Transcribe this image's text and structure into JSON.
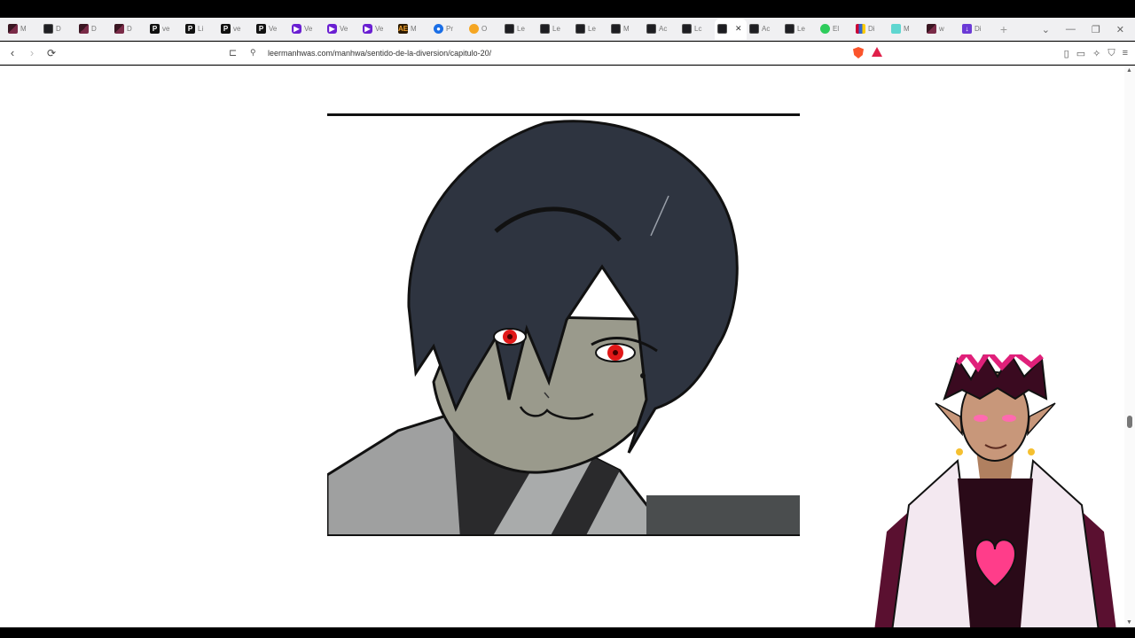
{
  "browser": {
    "tabs": [
      {
        "favicon": "manga-dark-favicon",
        "label": "M"
      },
      {
        "favicon": "manga-favicon",
        "label": "D"
      },
      {
        "favicon": "manga-dark-favicon",
        "label": "D"
      },
      {
        "favicon": "manga-dark-favicon",
        "label": "D"
      },
      {
        "favicon": "p-favicon",
        "label": "ve"
      },
      {
        "favicon": "p-favicon",
        "label": "Li"
      },
      {
        "favicon": "p-favicon",
        "label": "ve"
      },
      {
        "favicon": "p-favicon",
        "label": "Ve"
      },
      {
        "favicon": "purple-play-favicon",
        "label": "Ve"
      },
      {
        "favicon": "purple-play-favicon",
        "label": "Ve"
      },
      {
        "favicon": "purple-play-favicon",
        "label": "Ve"
      },
      {
        "favicon": "ae-favicon",
        "label": "M"
      },
      {
        "favicon": "blue-circle-favicon",
        "label": "Pr"
      },
      {
        "favicon": "orange-favicon",
        "label": "O"
      },
      {
        "favicon": "manga-favicon",
        "label": "Le"
      },
      {
        "favicon": "manga-favicon",
        "label": "Le"
      },
      {
        "favicon": "manga-favicon",
        "label": "Le"
      },
      {
        "favicon": "manga-favicon",
        "label": "M"
      },
      {
        "favicon": "manga-favicon",
        "label": "Ac"
      },
      {
        "favicon": "manga-favicon",
        "label": "Lc"
      }
    ],
    "active_tab": {
      "favicon": "manga-favicon",
      "label": "",
      "close": "✕"
    },
    "tabs_after": [
      {
        "favicon": "manga-favicon",
        "label": "Ac"
      },
      {
        "favicon": "manga-favicon",
        "label": "Le"
      },
      {
        "favicon": "green-favicon",
        "label": "El"
      },
      {
        "favicon": "multicolor-favicon",
        "label": "Di"
      },
      {
        "favicon": "teal-favicon",
        "label": "M"
      },
      {
        "favicon": "manga-dark-favicon",
        "label": "w"
      },
      {
        "favicon": "download-favicon",
        "label": "Di"
      }
    ],
    "new_tab": "+",
    "window_controls": {
      "dropdown": "⌄",
      "minimize": "—",
      "restore": "❐",
      "close": "✕"
    },
    "url": "leermanhwas.com/manhwa/sentido-de-la-diversion/capitulo-20/",
    "colors": {
      "tabstrip": "#f0f0f2",
      "brave_orange": "#fb542b",
      "rewards_red": "#e0204a"
    }
  },
  "page": {
    "comic_panel": "manhwa-character-panel",
    "avatar": "streamer-avatar-overlay"
  }
}
